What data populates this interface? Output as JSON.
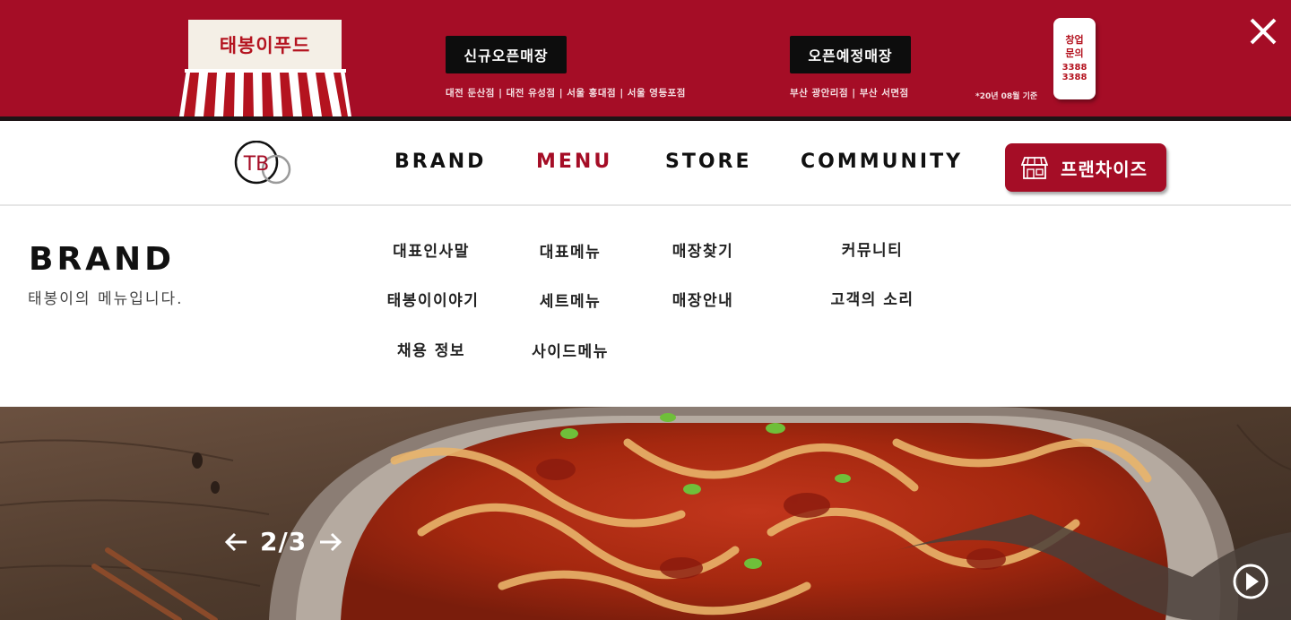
{
  "banner": {
    "logo_text": "태봉이푸드",
    "new_stores_label": "신규오픈매장",
    "new_stores_list": "대전 둔산점 | 대전 유성점 | 서울 홍대점 | 서울 영등포점",
    "upcoming_stores_label": "오픈예정매장",
    "upcoming_stores_list": "부산 광안리점 | 부산 서면점",
    "as_of_note": "*20년 08월 기준",
    "inquiry": {
      "line1": "창업",
      "line2": "문의",
      "phone": "3388 3388"
    },
    "colors": {
      "background": "#a50d26",
      "pill": "#0d0d0d"
    }
  },
  "nav": {
    "logo_text": "TB",
    "items": [
      {
        "label": "BRAND",
        "active": false
      },
      {
        "label": "MENU",
        "active": true
      },
      {
        "label": "STORE",
        "active": false
      },
      {
        "label": "COMMUNITY",
        "active": false
      }
    ],
    "franchise_label": "프랜차이즈",
    "accent_color": "#a50d26"
  },
  "mega_menu": {
    "title": "BRAND",
    "subtitle": "태봉이의 메뉴입니다.",
    "columns": [
      {
        "items": [
          "대표인사말",
          "태봉이이야기",
          "채용 정보"
        ]
      },
      {
        "items": [
          "대표메뉴",
          "세트메뉴",
          "사이드메뉴"
        ]
      },
      {
        "items": [
          "매장찾기",
          "매장안내"
        ]
      },
      {
        "items": [
          "커뮤니티",
          "고객의 소리"
        ]
      }
    ]
  },
  "hero": {
    "slide_counter": "2/3",
    "icons": {
      "prev": "arrow-left-icon",
      "next": "arrow-right-icon",
      "play": "play-circle-icon"
    }
  }
}
